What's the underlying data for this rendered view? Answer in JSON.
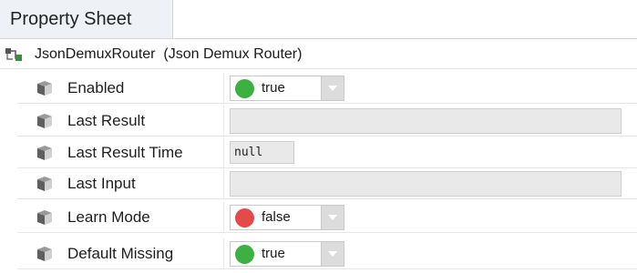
{
  "tab": {
    "title": "Property Sheet"
  },
  "root": {
    "label": "JsonDemuxRouter  (Json Demux Router)"
  },
  "properties": [
    {
      "name": "Enabled",
      "type": "boolean",
      "value": "true",
      "dot_color": "#3cb043"
    },
    {
      "name": "Last Result",
      "type": "text",
      "value": ""
    },
    {
      "name": "Last Result Time",
      "type": "null",
      "value": "null"
    },
    {
      "name": "Last Input",
      "type": "text",
      "value": ""
    },
    {
      "name": "Learn Mode",
      "type": "boolean",
      "value": "false",
      "dot_color": "#e34b4b"
    },
    {
      "name": "Default Missing",
      "type": "boolean",
      "value": "true",
      "dot_color": "#3cb043"
    }
  ]
}
